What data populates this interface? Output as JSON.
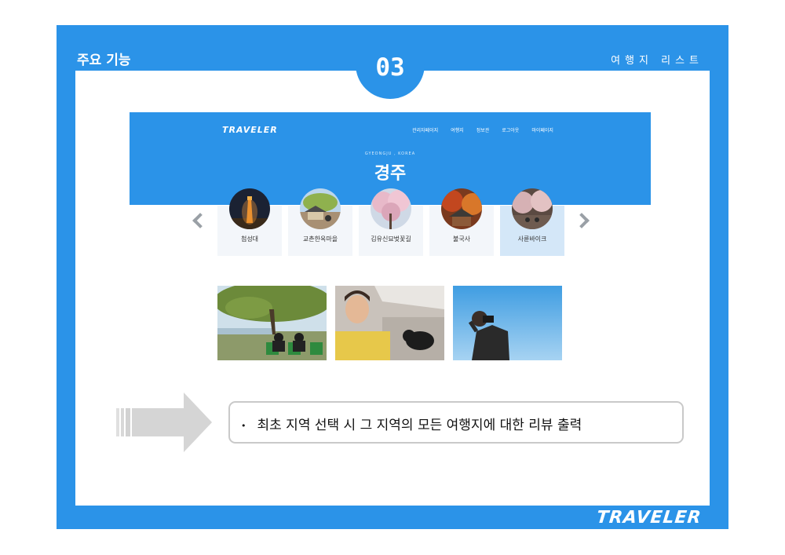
{
  "slide": {
    "section_title": "주요 기능",
    "section_label": "여행지 리스트",
    "number": "03",
    "brand": "TRAVELER"
  },
  "site": {
    "logo": "TRAVELER",
    "nav": [
      "관리자페이지",
      "여행지",
      "정보관",
      "로그아웃",
      "마이페이지"
    ],
    "subtitle": "GYEONGJU , KOREA",
    "city": "경주"
  },
  "places": [
    {
      "name": "첨성대",
      "active": false
    },
    {
      "name": "교촌한옥마을",
      "active": false
    },
    {
      "name": "김유신묘벚꽃길",
      "active": false
    },
    {
      "name": "불국사",
      "active": false
    },
    {
      "name": "사륜바이크",
      "active": true
    }
  ],
  "description": {
    "bullet": "•",
    "text": "최초 지역 선택 시 그 지역의 모든 여행지에 대한 리뷰 출력"
  },
  "icons": {
    "prev": "chevron-left-icon",
    "next": "chevron-right-icon",
    "pointer": "arrow-right-icon"
  },
  "colors": {
    "brand_blue": "#2b93e8",
    "active_card": "#d4e7f8"
  }
}
